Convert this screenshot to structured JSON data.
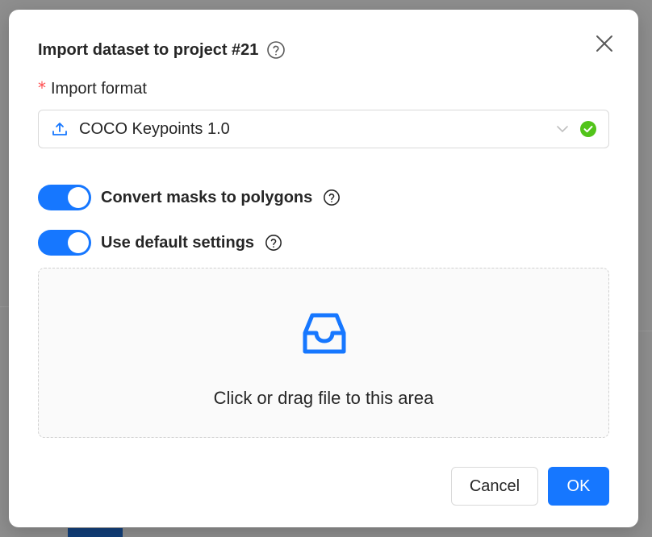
{
  "dialog": {
    "title": "Import dataset to project #21",
    "close_icon": "close-icon",
    "help_icon": "question-circle-icon"
  },
  "import_format": {
    "label": "Import format",
    "required_mark": "*",
    "selected": "COCO Keypoints 1.0",
    "leading_icon": "upload-icon",
    "trailing_icons": [
      "chevron-down-icon",
      "check-circle-icon"
    ],
    "status_color": "#52c41a"
  },
  "toggles": [
    {
      "label": "Convert masks to polygons",
      "on": true
    },
    {
      "label": "Use default settings",
      "on": true
    }
  ],
  "dropzone": {
    "icon": "inbox-icon",
    "hint": "Click or drag file to this area"
  },
  "footer": {
    "cancel_label": "Cancel",
    "ok_label": "OK"
  },
  "colors": {
    "primary": "#1677ff",
    "required": "#ff4d4f"
  }
}
